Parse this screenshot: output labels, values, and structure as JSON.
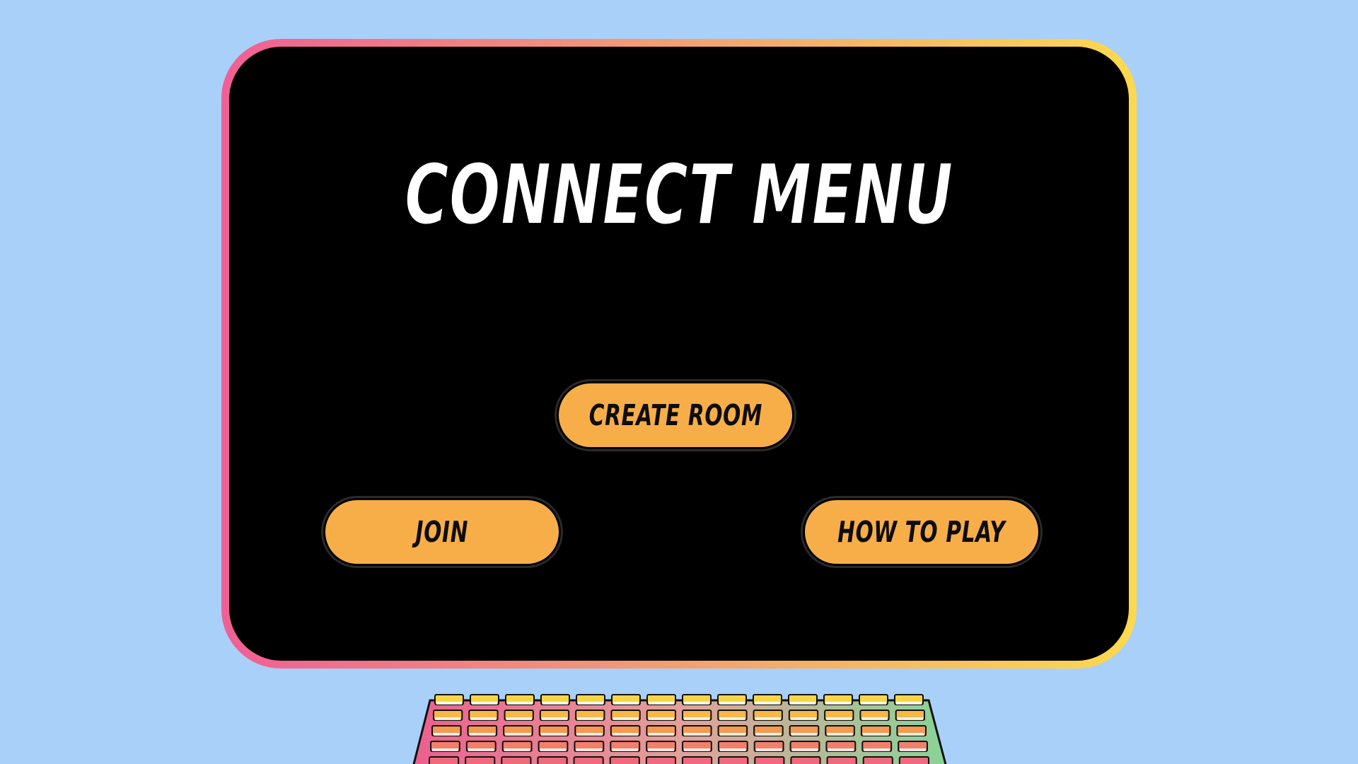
{
  "menu": {
    "title": "CONNECT MENU",
    "buttons": {
      "create_room": "CREATE ROOM",
      "join": "JOIN",
      "how_to_play": "HOW TO PLAY"
    }
  },
  "colors": {
    "background": "#a9d0f8",
    "screen": "#000000",
    "title_text": "#ffffff",
    "button_fill": "#f8ae48",
    "button_text": "#0d0d0d",
    "frame_gradient": [
      "#f05f95",
      "#f3a070",
      "#fcd94f"
    ],
    "keyboard_case_gradient": [
      "#ec5f8e",
      "#e3a09a",
      "#88d496"
    ],
    "keycap_rows": [
      "#f6d648",
      "#f8b848",
      "#f59a52",
      "#f27f6a",
      "#ef6a7c"
    ]
  },
  "decor": {
    "keyboard": "keyboard-illustration"
  }
}
